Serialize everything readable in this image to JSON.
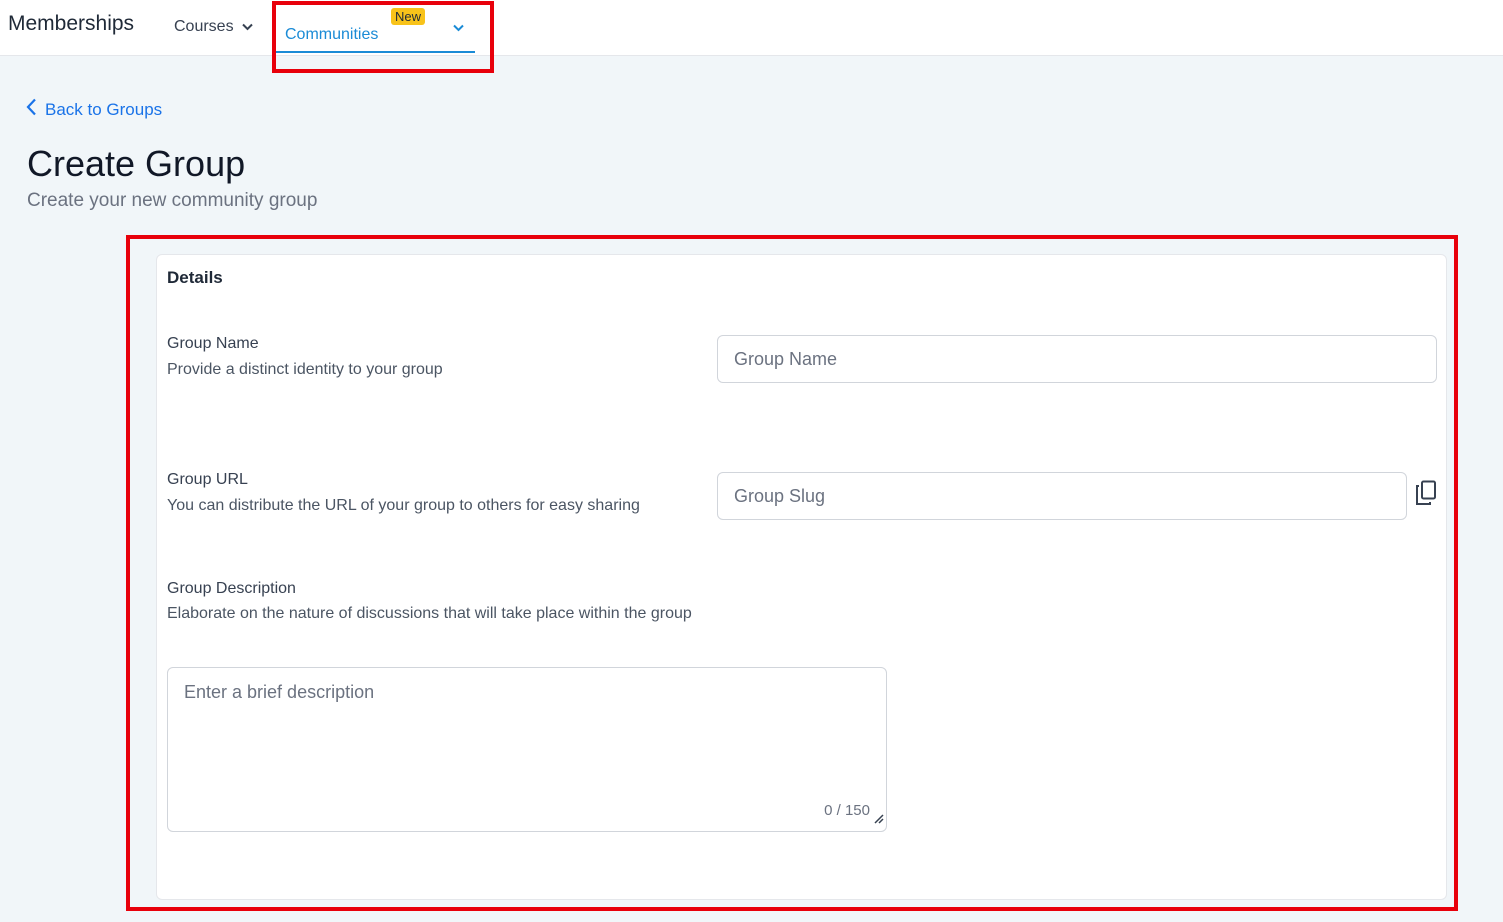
{
  "header": {
    "brand": "Memberships",
    "nav": {
      "courses_label": "Courses",
      "communities_label": "Communities",
      "communities_badge": "New"
    }
  },
  "page": {
    "back_link": "Back to Groups",
    "title": "Create Group",
    "subtitle": "Create your new community group"
  },
  "details": {
    "title": "Details",
    "group_name": {
      "label": "Group Name",
      "help": "Provide a distinct identity to your group",
      "placeholder": "Group Name",
      "value": ""
    },
    "group_url": {
      "label": "Group URL",
      "help": "You can distribute the URL of your group to others for easy sharing",
      "placeholder": "Group Slug",
      "value": ""
    },
    "group_description": {
      "label": "Group Description",
      "help": "Elaborate on the nature of discussions that will take place within the group",
      "placeholder": "Enter a brief description",
      "char_count": "0 / 150"
    }
  },
  "icons": {
    "courses_chevron": "chevron-down-icon",
    "communities_chevron": "chevron-down-icon",
    "back": "chevron-left-icon",
    "copy": "copy-icon",
    "resize": "resize-grip-icon"
  },
  "colors": {
    "accent": "#1a8bd6",
    "link": "#1a73e8",
    "badge": "#f8c31a",
    "highlight": "#e8000b",
    "page_bg": "#f1f6f9"
  }
}
